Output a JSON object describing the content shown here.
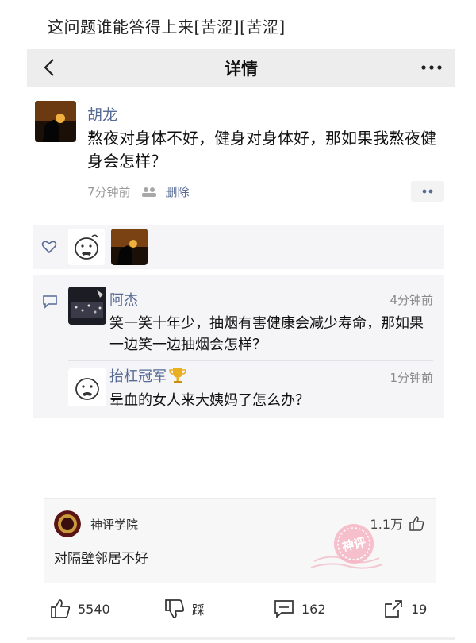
{
  "caption": "这问题谁能答得上来[苦涩][苦涩]",
  "header": {
    "title": "详情"
  },
  "post": {
    "author": "胡龙",
    "text": "熬夜对身体不好，健身对身体好，那如果我熬夜健身会怎样？",
    "time": "7分钟前",
    "delete_label": "删除"
  },
  "comments": [
    {
      "name": "阿杰",
      "time": "4分钟前",
      "text": "笑一笑十年少，抽烟有害健康会减少寿命，那如果一边笑一边抽烟会怎样？"
    },
    {
      "name": "抬杠冠军",
      "time": "1分钟前",
      "text": "晕血的女人来大姨妈了怎么办？"
    }
  ],
  "hot_comment": {
    "user": "神评学院",
    "likes": "1.1万",
    "text": "对隔壁邻居不好",
    "stamp_text": "神评"
  },
  "actions": {
    "like_count": "5540",
    "dislike_label": "踩",
    "comment_count": "162",
    "share_count": "19"
  },
  "colors": {
    "link": "#576b95",
    "panel": "#f5f5f7",
    "stamp": "#e8607a"
  }
}
